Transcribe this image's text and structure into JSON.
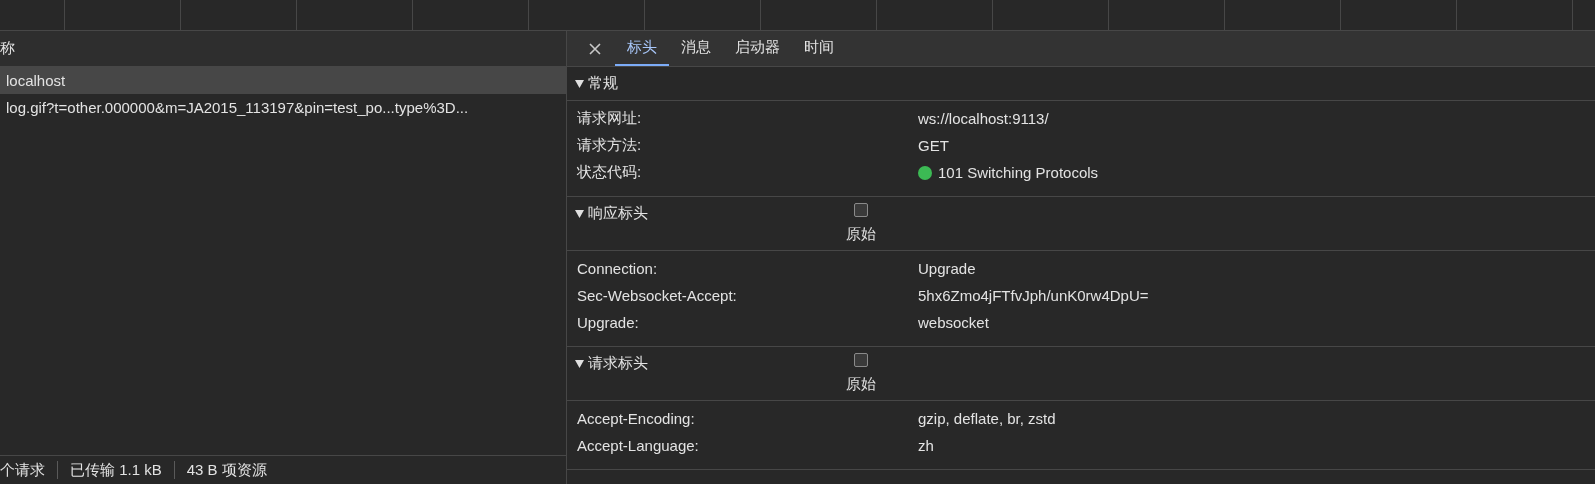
{
  "request_list": {
    "column_header": "称",
    "rows": [
      {
        "name": "localhost",
        "selected": true
      },
      {
        "name": "log.gif?t=other.000000&m=JA2015_113197&pin=test_po...type%3D...",
        "selected": false
      }
    ]
  },
  "status_bar": [
    "个请求",
    "已传输 1.1 kB",
    "43 B 项资源"
  ],
  "details": {
    "tabs": [
      {
        "label": "标头",
        "selected": true
      },
      {
        "label": "消息",
        "selected": false
      },
      {
        "label": "启动器",
        "selected": false
      },
      {
        "label": "时间",
        "selected": false
      }
    ],
    "sections": [
      {
        "title": "常规",
        "expanded": true,
        "rows": [
          {
            "kind": "text",
            "name": "请求网址:",
            "value": "ws://localhost:9113/"
          },
          {
            "kind": "text",
            "name": "请求方法:",
            "value": "GET"
          },
          {
            "kind": "status",
            "name": "状态代码:",
            "value": "101 Switching Protocols",
            "color": "#3cba54"
          }
        ]
      },
      {
        "title": "响应标头",
        "expanded": true,
        "raw_toggle": {
          "label": "原始",
          "checked": false
        },
        "rows": [
          {
            "kind": "text",
            "name": "Connection:",
            "value": "Upgrade"
          },
          {
            "kind": "text",
            "name": "Sec-Websocket-Accept:",
            "value": "5hx6Zmo4jFTfvJph/unK0rw4DpU="
          },
          {
            "kind": "text",
            "name": "Upgrade:",
            "value": "websocket"
          }
        ]
      },
      {
        "title": "请求标头",
        "expanded": true,
        "raw_toggle": {
          "label": "原始",
          "checked": false
        },
        "rows": [
          {
            "kind": "text",
            "name": "Accept-Encoding:",
            "value": "gzip, deflate, br, zstd"
          },
          {
            "kind": "text",
            "name": "Accept-Language:",
            "value": "zh"
          }
        ]
      }
    ]
  }
}
